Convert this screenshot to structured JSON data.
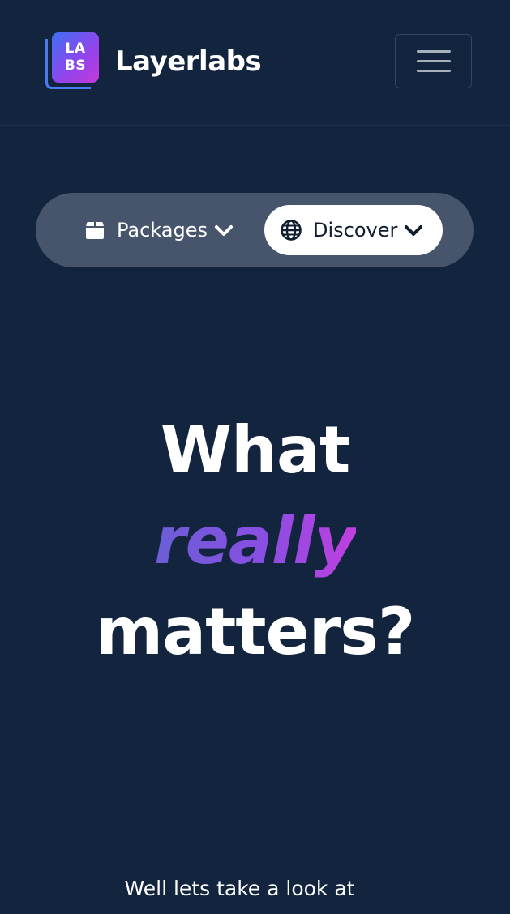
{
  "navbar": {
    "logo_line1": "LA",
    "logo_line2": "BS",
    "brand_name": "Layerlabs",
    "menu_icon": "hamburger-menu-icon"
  },
  "pill_nav": {
    "items": [
      {
        "label": "Packages",
        "icon": "box-icon",
        "active": false
      },
      {
        "label": "Discover",
        "icon": "globe-icon",
        "active": true
      }
    ]
  },
  "hero": {
    "line1": "What",
    "accent": "really",
    "line3": "matters?"
  },
  "lead": {
    "text": "Well lets take a look at"
  },
  "colors": {
    "background": "#13253e",
    "pill_background": "#46556b",
    "accent_gradient_start": "#6a5fd6",
    "accent_gradient_end": "#c13fe0",
    "logo_gradient_start": "#3d6ff2",
    "logo_gradient_end": "#c43ad9"
  }
}
